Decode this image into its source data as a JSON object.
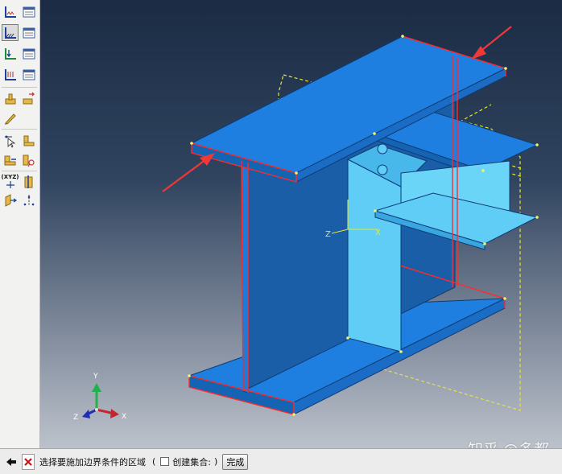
{
  "toolbox": {
    "tools": [
      {
        "name": "boundary-condition-create-icon",
        "active": false
      },
      {
        "name": "boundary-condition-manager-icon",
        "active": false
      },
      {
        "name": "symmetry-boundary-create-icon",
        "active": true
      },
      {
        "name": "symmetry-boundary-manager-icon",
        "active": false
      },
      {
        "name": "load-create-icon",
        "active": false
      },
      {
        "name": "load-manager-icon",
        "active": false
      },
      {
        "name": "predefined-field-create-icon",
        "active": false
      },
      {
        "name": "predefined-field-manager-icon",
        "active": false
      },
      {
        "name": "datum-point-icon",
        "active": false
      },
      {
        "name": "datum-axis-icon",
        "active": false
      },
      {
        "name": "edit-feature-icon",
        "active": false
      },
      {
        "name": "query-pick-icon",
        "active": false
      },
      {
        "name": "partition-face-icon",
        "active": false
      },
      {
        "name": "partition-edge-icon",
        "active": false
      },
      {
        "name": "partition-cell-icon",
        "active": false
      },
      {
        "name": "coordinate-system-icon",
        "active": false
      },
      {
        "name": "section-view-icon",
        "active": false
      },
      {
        "name": "translate-view-icon",
        "active": false
      },
      {
        "name": "rotate-axis-icon",
        "active": false
      }
    ],
    "coord_label": "(XYZ)"
  },
  "triad": {
    "y_label": "Y",
    "z_label": "Z",
    "x_label": "X"
  },
  "csys": {
    "z_label": "Z",
    "x_label": "X"
  },
  "prompt": {
    "text": "选择要施加边界条件的区域",
    "paren_open": "(",
    "checkbox_label": "创建集合:",
    "paren_close": ")",
    "done_label": "完成"
  },
  "watermark": "知乎 @多都",
  "colors": {
    "viewport_top": "#1b2b44",
    "viewport_bottom": "#bcc2cb",
    "beam_face": "#1e7fe0",
    "beam_light": "#5fcdf6",
    "selected_edge": "#ff2b2b",
    "datum_plane": "#e5e82a",
    "arrow": "#ef3838"
  }
}
